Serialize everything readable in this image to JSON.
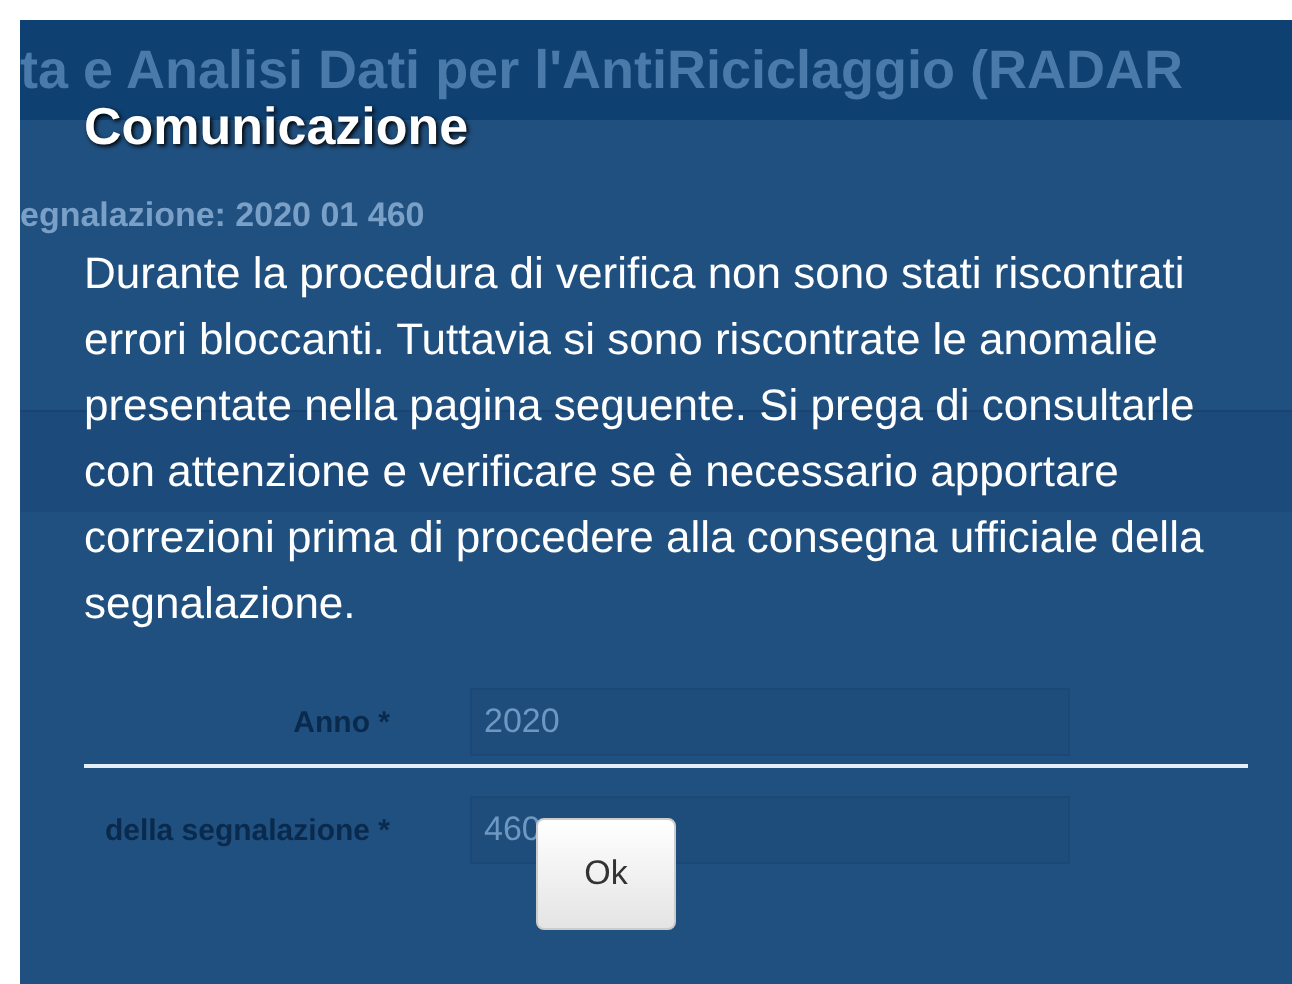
{
  "background_page": {
    "title": "ta e Analisi Dati per l'AntiRiciclaggio (RADAR",
    "subtitle": "egnalazione: 2020 01 460",
    "fields": [
      {
        "label": "Anno *",
        "value": "2020"
      },
      {
        "label": "della segnalazione *",
        "value": "460"
      }
    ]
  },
  "dialog": {
    "title": "Comunicazione",
    "message": "Durante la procedura di verifica non sono stati riscontrati errori bloccanti. Tuttavia si sono riscontrate le anomalie presentate nella pagina seguente. Si prega di consultarle con attenzione e verificare se è necessario apportare correzioni prima di procedere alla consegna ufficiale della segnalazione.",
    "buttons": [
      "Ok"
    ]
  }
}
